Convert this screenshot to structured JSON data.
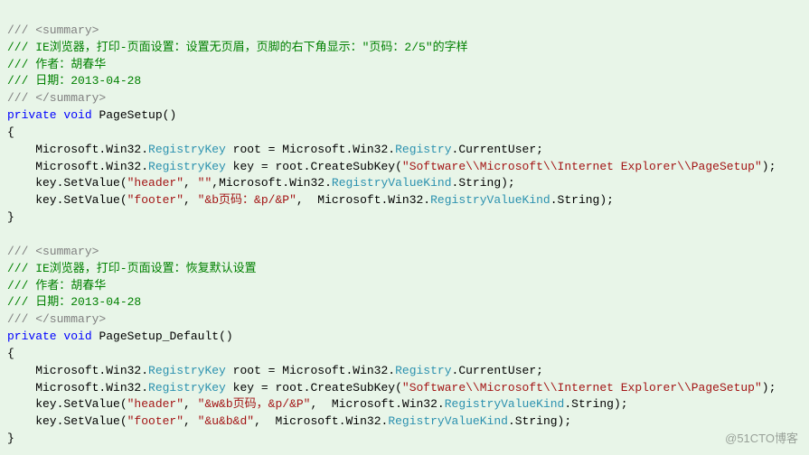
{
  "block1": {
    "xml_open": "/// <summary>",
    "summary": "/// IE浏览器，打印-页面设置：设置无页眉，页脚的右下角显示：\"页码：2/5\"的字样",
    "author": "/// 作者：胡春华",
    "date": "/// 日期：2013-04-28",
    "xml_close": "/// </summary>",
    "kw_private": "private",
    "kw_void": "void",
    "method": "PageSetup",
    "ns1a": "    Microsoft.Win32.",
    "type1": "RegistryKey",
    "mid1": " root = Microsoft.Win32.",
    "type2": "Registry",
    "tail1": ".CurrentUser;",
    "ns2a": "    Microsoft.Win32.",
    "mid2": " key = root.CreateSubKey(",
    "str_path": "\"Software\\\\Microsoft\\\\Internet Explorer\\\\PageSetup\"",
    "tail2": ");",
    "l3a": "    key.SetValue(",
    "str_header": "\"header\"",
    "sep": ", ",
    "str_empty": "\"\"",
    "l3b": ",Microsoft.Win32.",
    "rvk": "RegistryValueKind",
    "tail3": ".String);",
    "l4a": "    key.SetValue(",
    "str_footer": "\"footer\"",
    "str_footer_val": "\"&b页码：&p/&P\"",
    "l4b": ",  Microsoft.Win32.",
    "tail4": ".String);"
  },
  "block2": {
    "xml_open": "/// <summary>",
    "summary": "/// IE浏览器，打印-页面设置：恢复默认设置",
    "author": "/// 作者：胡春华",
    "date": "/// 日期：2013-04-28",
    "xml_close": "/// </summary>",
    "kw_private": "private",
    "kw_void": "void",
    "method": "PageSetup_Default",
    "ns1a": "    Microsoft.Win32.",
    "type1": "RegistryKey",
    "mid1": " root = Microsoft.Win32.",
    "type2": "Registry",
    "tail1": ".CurrentUser;",
    "ns2a": "    Microsoft.Win32.",
    "mid2": " key = root.CreateSubKey(",
    "str_path": "\"Software\\\\Microsoft\\\\Internet Explorer\\\\PageSetup\"",
    "tail2": ");",
    "l3a": "    key.SetValue(",
    "str_header": "\"header\"",
    "sep": ", ",
    "str_header_val": "\"&w&b页码，&p/&P\"",
    "l3b": ",  Microsoft.Win32.",
    "rvk": "RegistryValueKind",
    "tail3": ".String);",
    "l4a": "    key.SetValue(",
    "str_footer": "\"footer\"",
    "str_footer_val": "\"&u&b&d\"",
    "l4b": ",  Microsoft.Win32.",
    "tail4": ".String);"
  },
  "braces": {
    "open": "{",
    "close": "}",
    "paren_empty": "()"
  },
  "watermark": "@51CTO博客"
}
